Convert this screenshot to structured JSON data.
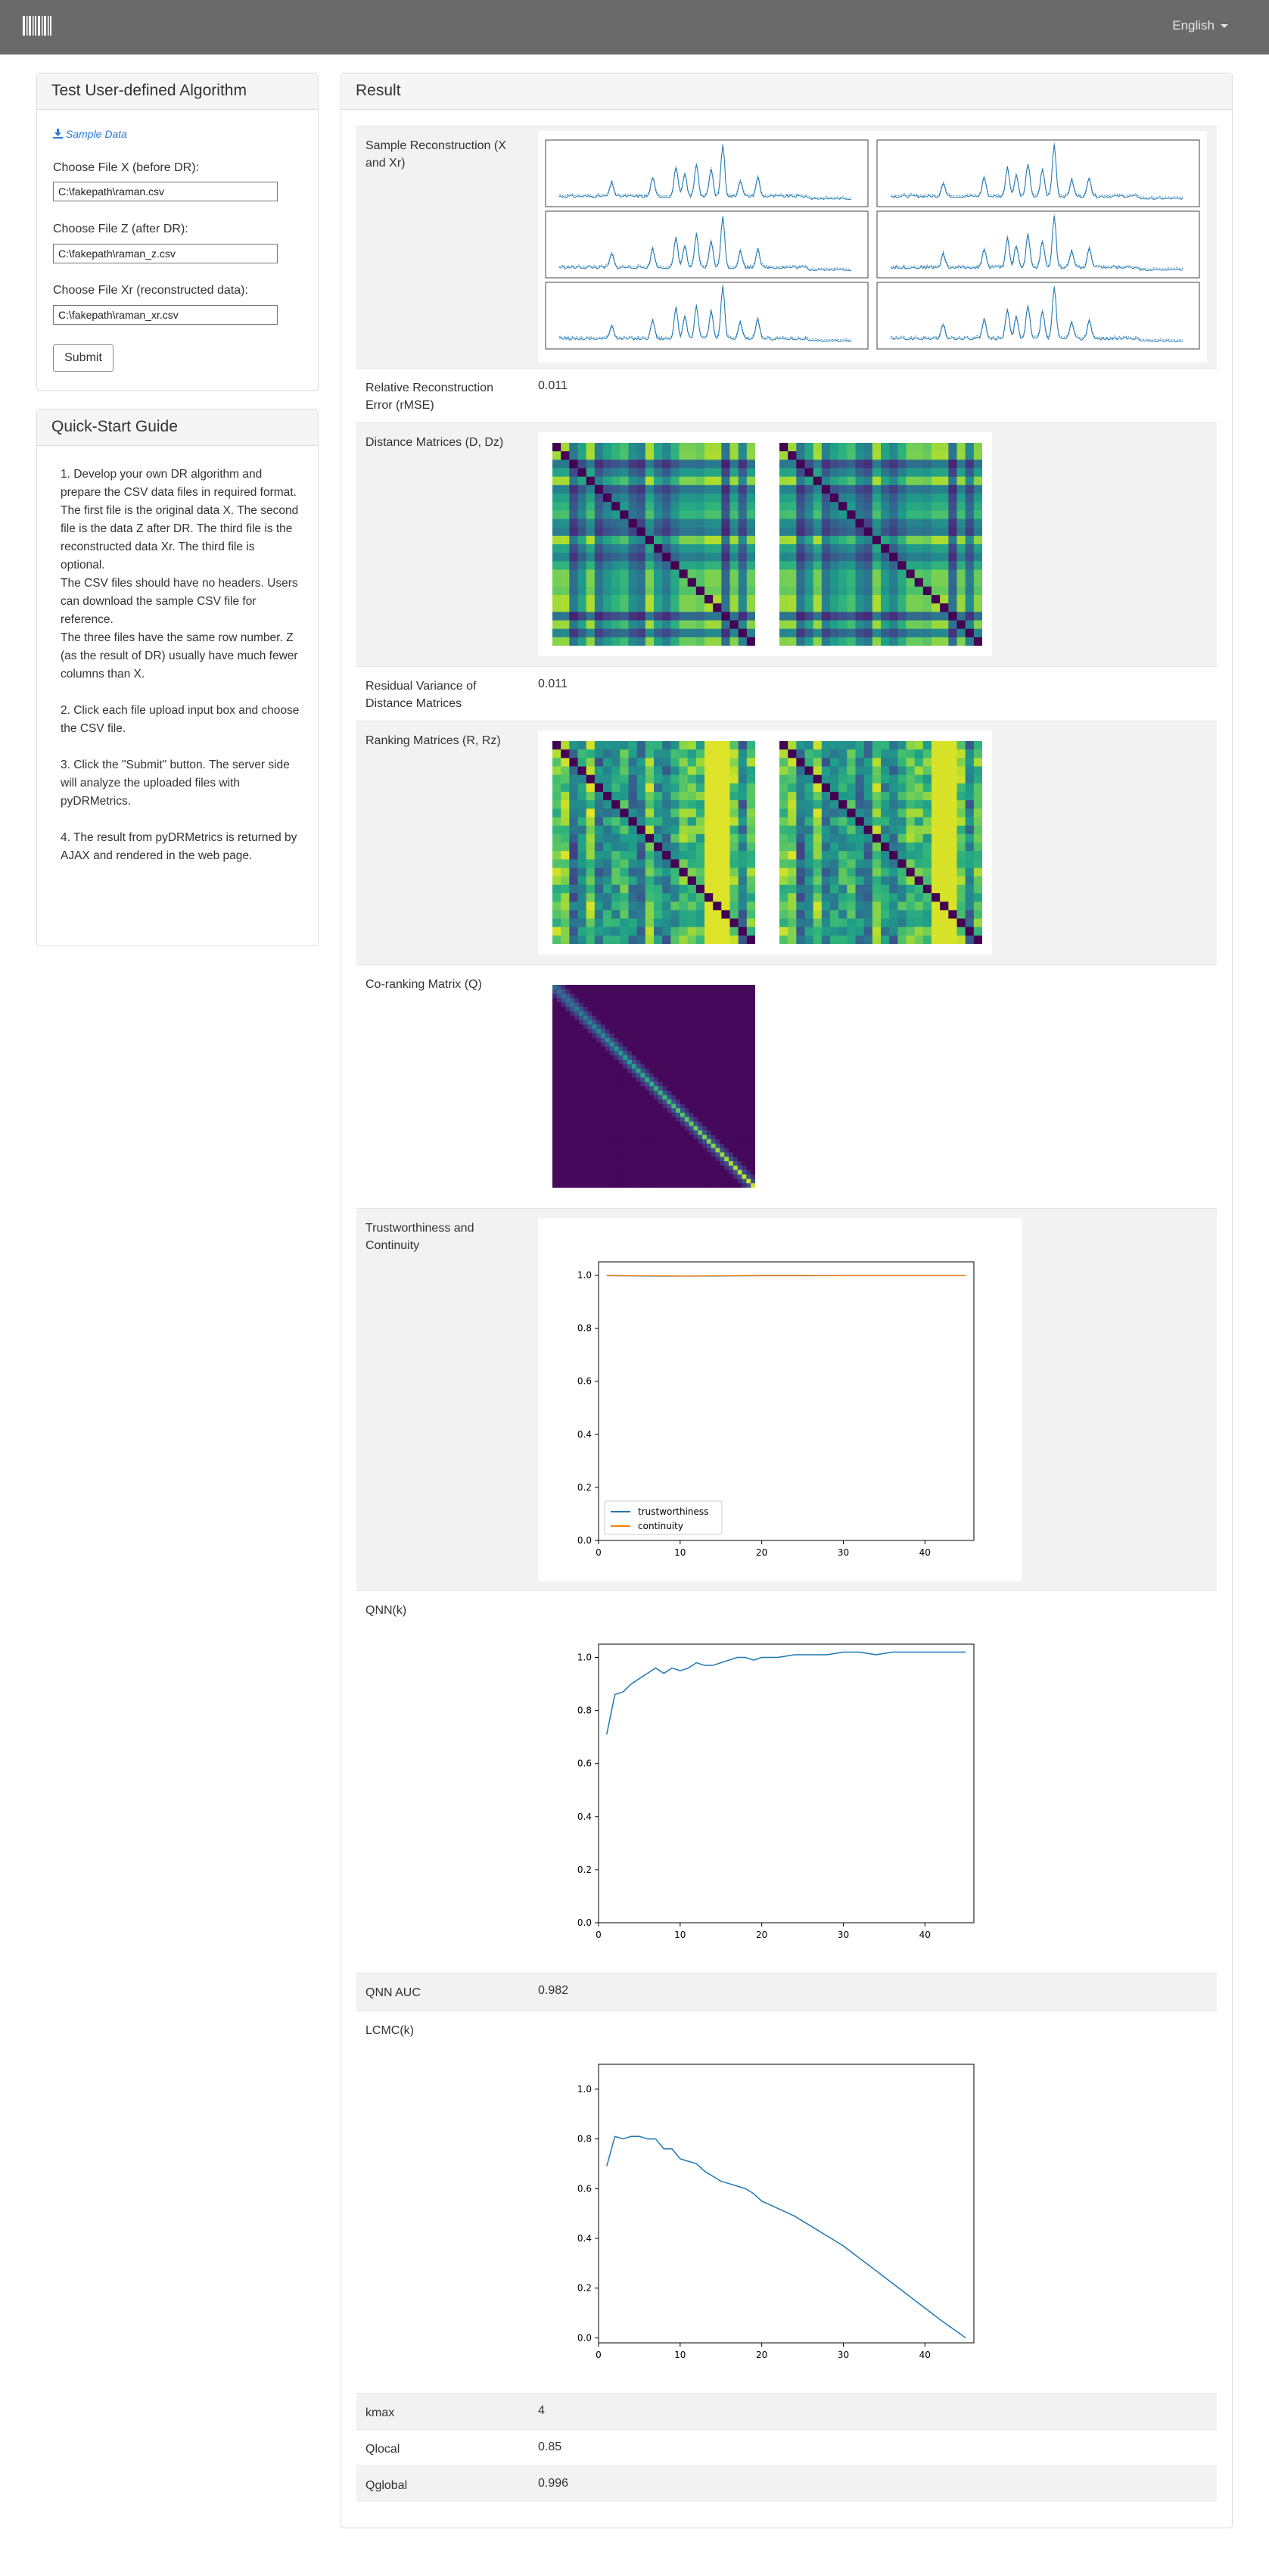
{
  "nav": {
    "language": "English"
  },
  "test_panel": {
    "title": "Test User-defined Algorithm",
    "sample_link": "Sample Data",
    "fields": [
      {
        "label": "Choose File X (before DR):",
        "value": "C:\\fakepath\\raman.csv"
      },
      {
        "label": "Choose File Z (after DR):",
        "value": "C:\\fakepath\\raman_z.csv"
      },
      {
        "label": "Choose File Xr (reconstructed data):",
        "value": "C:\\fakepath\\raman_xr.csv"
      }
    ],
    "submit": "Submit"
  },
  "guide_panel": {
    "title": "Quick-Start Guide",
    "paragraphs": [
      "1. Develop your own DR algorithm and prepare the CSV data files in required format.\nThe first file is the original data X. The second file is the data Z after DR. The third file is the reconstructed data Xr. The third file is optional.\nThe CSV files should have no headers. Users can download the sample CSV file for reference.\nThe three files have the same row number. Z (as the result of DR) usually have much fewer columns than X.",
      "2. Click each file upload input box and choose the CSV file.",
      "3. Click the \"Submit\" button. The server side will analyze the uploaded files with pyDRMetrics.",
      "4. The result from pyDRMetrics is returned by AJAX and rendered in the web page."
    ]
  },
  "result": {
    "title": "Result",
    "rows": {
      "sample_reconstruction": "Sample Reconstruction (X and Xr)",
      "rmse_label": "Relative Reconstruction Error (rMSE)",
      "rmse_value": "0.011",
      "distance_label": "Distance Matrices (D, Dz)",
      "residual_label": "Residual Variance of Distance Matrices",
      "residual_value": "0.011",
      "ranking_label": "Ranking Matrices (R, Rz)",
      "coranking_label": "Co-ranking Matrix (Q)",
      "tc_label": "Trustworthiness and Continuity",
      "qnn_label": "QNN(k)",
      "qnn_auc_label": "QNN AUC",
      "qnn_auc_value": "0.982",
      "lcmc_label": "LCMC(k)",
      "kmax_label": "kmax",
      "kmax_value": "4",
      "qlocal_label": "Qlocal",
      "qlocal_value": "0.85",
      "qglobal_label": "Qglobal",
      "qglobal_value": "0.996"
    }
  },
  "chart_data": [
    {
      "type": "line",
      "name": "trustworthiness-continuity",
      "xlim": [
        0,
        46
      ],
      "ylim": [
        0,
        1.05
      ],
      "xticks": [
        0,
        10,
        20,
        30,
        40
      ],
      "yticks": [
        0.0,
        0.2,
        0.4,
        0.6,
        0.8,
        1.0
      ],
      "legend": "lower-left",
      "series": [
        {
          "name": "trustworthiness",
          "color": "#1f77b4",
          "x": [
            1,
            5,
            10,
            15,
            20,
            25,
            30,
            35,
            40,
            45
          ],
          "y": [
            0.998,
            0.997,
            0.996,
            0.997,
            0.998,
            0.998,
            0.999,
            0.999,
            0.999,
            0.999
          ]
        },
        {
          "name": "continuity",
          "color": "#ff7f0e",
          "x": [
            1,
            5,
            10,
            15,
            20,
            25,
            30,
            35,
            40,
            45
          ],
          "y": [
            0.999,
            0.998,
            0.997,
            0.998,
            0.999,
            0.999,
            0.999,
            0.999,
            0.999,
            0.999
          ]
        }
      ]
    },
    {
      "type": "line",
      "name": "qnn",
      "xlim": [
        0,
        46
      ],
      "ylim": [
        0,
        1.05
      ],
      "xticks": [
        0,
        10,
        20,
        30,
        40
      ],
      "yticks": [
        0.0,
        0.2,
        0.4,
        0.6,
        0.8,
        1.0
      ],
      "series": [
        {
          "color": "#1f77b4",
          "x": [
            1,
            2,
            3,
            4,
            5,
            6,
            7,
            8,
            9,
            10,
            11,
            12,
            13,
            14,
            15,
            16,
            17,
            18,
            19,
            20,
            22,
            24,
            26,
            28,
            30,
            32,
            34,
            36,
            38,
            40,
            42,
            45
          ],
          "y": [
            0.71,
            0.86,
            0.87,
            0.9,
            0.92,
            0.94,
            0.96,
            0.94,
            0.96,
            0.95,
            0.96,
            0.98,
            0.97,
            0.97,
            0.98,
            0.99,
            1.0,
            1.0,
            0.99,
            1.0,
            1.0,
            1.01,
            1.01,
            1.01,
            1.02,
            1.02,
            1.01,
            1.02,
            1.02,
            1.02,
            1.02,
            1.02
          ]
        }
      ]
    },
    {
      "type": "line",
      "name": "lcmc",
      "xlim": [
        0,
        46
      ],
      "ylim": [
        -0.02,
        1.1
      ],
      "xticks": [
        0,
        10,
        20,
        30,
        40
      ],
      "yticks": [
        0.0,
        0.2,
        0.4,
        0.6,
        0.8,
        1.0
      ],
      "series": [
        {
          "color": "#1f77b4",
          "x": [
            1,
            2,
            3,
            4,
            5,
            6,
            7,
            8,
            9,
            10,
            11,
            12,
            13,
            14,
            15,
            16,
            17,
            18,
            19,
            20,
            22,
            24,
            26,
            28,
            30,
            32,
            34,
            36,
            38,
            40,
            42,
            45
          ],
          "y": [
            0.69,
            0.81,
            0.8,
            0.81,
            0.81,
            0.8,
            0.8,
            0.76,
            0.76,
            0.72,
            0.71,
            0.7,
            0.67,
            0.65,
            0.63,
            0.62,
            0.61,
            0.6,
            0.58,
            0.55,
            0.52,
            0.49,
            0.45,
            0.41,
            0.37,
            0.32,
            0.27,
            0.22,
            0.17,
            0.12,
            0.07,
            0.0
          ]
        }
      ]
    }
  ]
}
